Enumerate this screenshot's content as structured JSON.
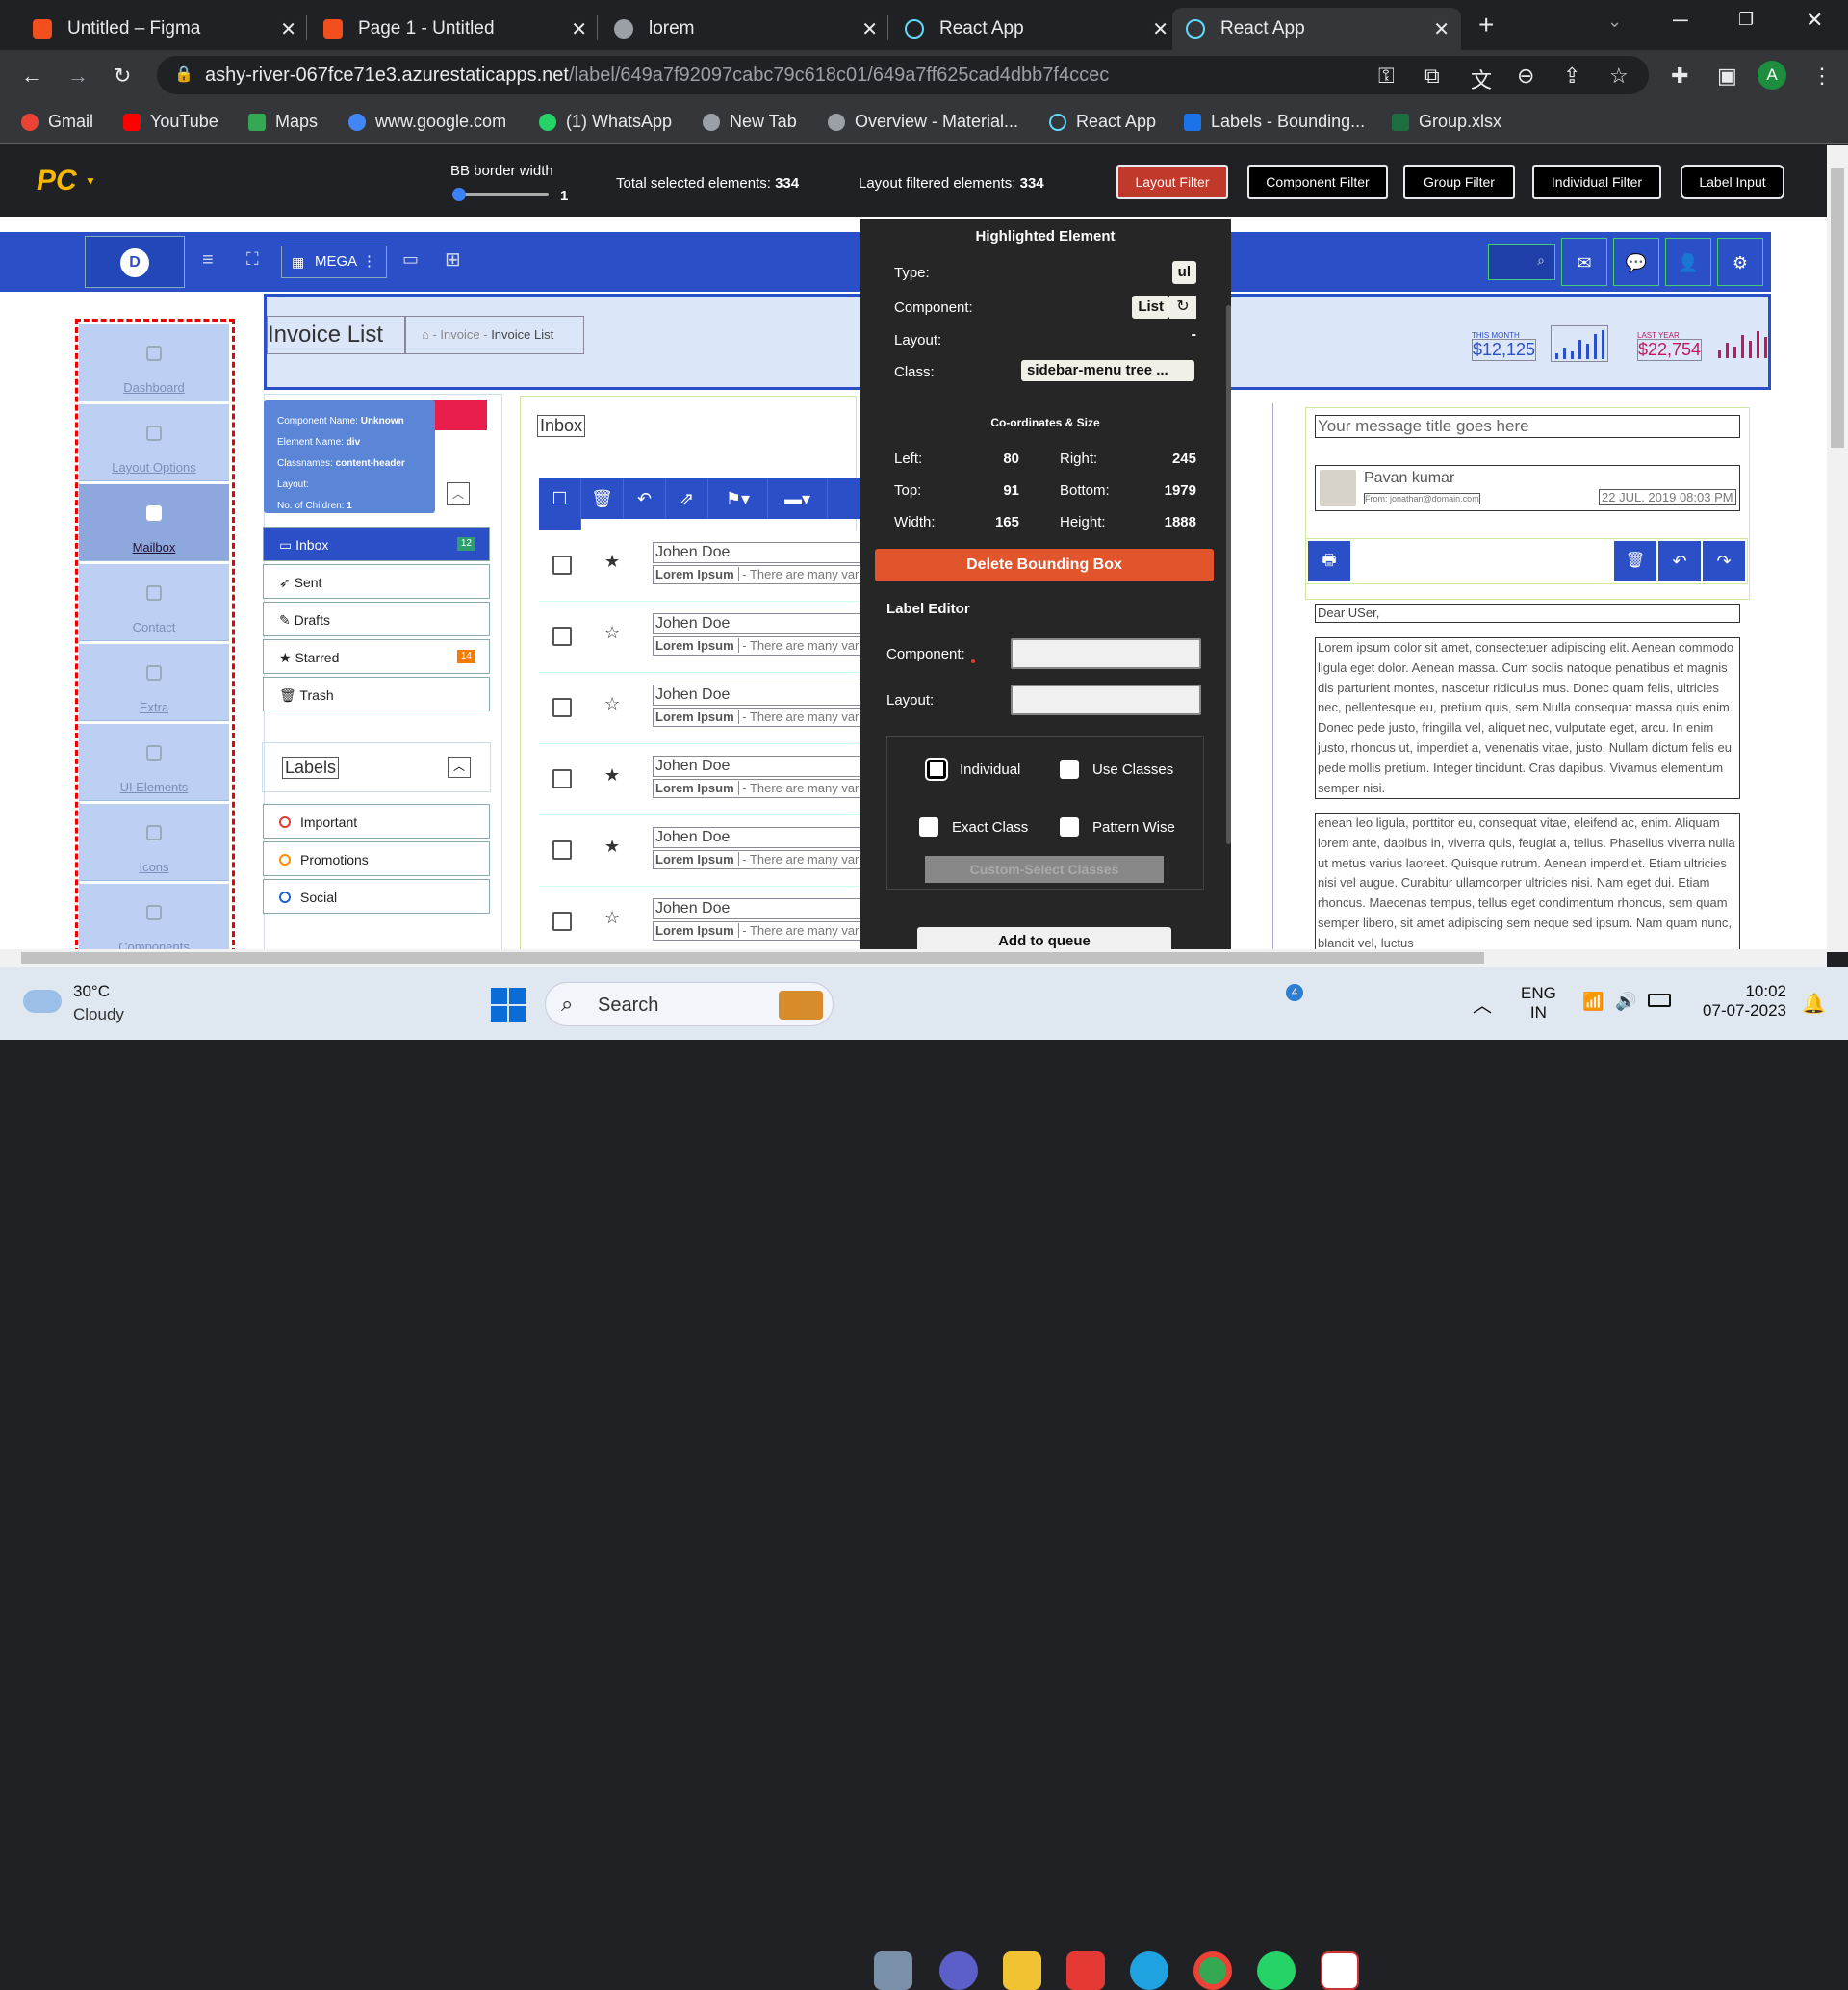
{
  "browser": {
    "tabs": [
      {
        "title": "Untitled – Figma",
        "color": "#f24e1e"
      },
      {
        "title": "Page 1 - Untitled",
        "color": "#f24e1e"
      },
      {
        "title": "lorem",
        "color": "#9aa0a6"
      },
      {
        "title": "React App",
        "color": "#61dafb"
      },
      {
        "title": "React App",
        "color": "#61dafb"
      }
    ],
    "url_domain": "ashy-river-067fce71e3.azurestaticapps.net",
    "url_path": "/label/649a7f92097cabc79c618c01/649a7ff625cad4dbb7f4ccec",
    "profile_initial": "A",
    "bookmarks": [
      "Gmail",
      "YouTube",
      "Maps",
      "www.google.com",
      "(1) WhatsApp",
      "New Tab",
      "Overview - Material...",
      "React App",
      "Labels - Bounding...",
      "Group.xlsx"
    ]
  },
  "toolbar": {
    "logo": "PC",
    "bb_label": "BB border width",
    "bb_value": "1",
    "bb_slider_fraction": 0.0,
    "total_label": "Total selected elements:",
    "total_value": "334",
    "layout_label": "Layout filtered elements:",
    "layout_value": "334",
    "filters": [
      "Layout Filter",
      "Component Filter",
      "Group Filter",
      "Individual Filter",
      "Label Input"
    ]
  },
  "app": {
    "mega": "MEGA",
    "sidebar": [
      "Dashboard",
      "Layout Options",
      "Mailbox",
      "Contact",
      "Extra",
      "UI Elements",
      "Icons",
      "Components"
    ],
    "page_title": "Invoice List",
    "breadcrumb": [
      "Invoice",
      "Invoice List"
    ],
    "stat1_label": "THIS MONTH",
    "stat1_value": "$12,125",
    "stat2_label": "LAST YEAR",
    "stat2_value": "$22,754",
    "tooltip": {
      "component_label": "Component Name:",
      "component_value": "Unknown",
      "element_label": "Element Name:",
      "element_value": "div",
      "class_label": "Classnames:",
      "class_value": "content-header",
      "layout_label": "Layout:",
      "children_label": "No. of Children:",
      "children_value": "1"
    },
    "folders": [
      {
        "label": "Inbox",
        "badge": "12"
      },
      {
        "label": "Sent",
        "badge": ""
      },
      {
        "label": "Drafts",
        "badge": ""
      },
      {
        "label": "Starred",
        "badge": "14"
      },
      {
        "label": "Trash",
        "badge": ""
      }
    ],
    "labels_title": "Labels",
    "labels": [
      {
        "label": "Important",
        "color": "#e53935"
      },
      {
        "label": "Promotions",
        "color": "#fb8c00"
      },
      {
        "label": "Social",
        "color": "#1e63c8"
      }
    ],
    "inbox_title": "Inbox",
    "mails": [
      {
        "name": "Johen Doe",
        "subject": "Lorem Ipsum",
        "preview": "- There are many vari",
        "starred": true
      },
      {
        "name": "Johen Doe",
        "subject": "Lorem Ipsum",
        "preview": "- There are many vari",
        "starred": false
      },
      {
        "name": "Johen Doe",
        "subject": "Lorem Ipsum",
        "preview": "- There are many vari",
        "starred": false
      },
      {
        "name": "Johen Doe",
        "subject": "Lorem Ipsum",
        "preview": "- There are many vari",
        "starred": true
      },
      {
        "name": "Johen Doe",
        "subject": "Lorem Ipsum",
        "preview": "- There are many vari",
        "starred": true
      },
      {
        "name": "Johen Doe",
        "subject": "Lorem Ipsum",
        "preview": "- There are many vari",
        "starred": false
      }
    ],
    "message": {
      "title_placeholder": "Your message title goes here",
      "sender": "Pavan kumar",
      "from": "From: jonathan@domain.com",
      "date": "22 JUL. 2019 08:03 PM",
      "greeting": "Dear USer,",
      "para1": "Lorem ipsum dolor sit amet, consectetuer adipiscing elit. Aenean commodo ligula eget dolor. Aenean massa. Cum sociis natoque penatibus et magnis dis parturient montes, nascetur ridiculus mus. Donec quam felis, ultricies nec, pellentesque eu, pretium quis, sem.Nulla consequat massa quis enim. Donec pede justo, fringilla vel, aliquet nec, vulputate eget, arcu. In enim justo, rhoncus ut, imperdiet a, venenatis vitae, justo. Nullam dictum felis eu pede mollis pretium. Integer tincidunt. Cras dapibus. Vivamus elementum semper nisi.",
      "para2": "enean leo ligula, porttitor eu, consequat vitae, eleifend ac, enim. Aliquam lorem ante, dapibus in, viverra quis, feugiat a, tellus. Phasellus viverra nulla ut metus varius laoreet. Quisque rutrum. Aenean imperdiet. Etiam ultricies nisi vel augue. Curabitur ullamcorper ultricies nisi. Nam eget dui. Etiam rhoncus. Maecenas tempus, tellus eget condimentum rhoncus, sem quam semper libero, sit amet adipiscing sem neque sed ipsum. Nam quam nunc, blandit vel, luctus"
    }
  },
  "panel": {
    "title": "Highlighted Element",
    "type_label": "Type:",
    "type_value": "ul",
    "component_label": "Component:",
    "component_value": "List",
    "layout_label": "Layout:",
    "layout_value": "-",
    "class_label": "Class:",
    "class_value": "sidebar-menu tree ...",
    "coords_title": "Co-ordinates & Size",
    "left_label": "Left:",
    "left_value": "80",
    "right_label": "Right:",
    "right_value": "245",
    "top_label": "Top:",
    "top_value": "91",
    "bottom_label": "Bottom:",
    "bottom_value": "1979",
    "width_label": "Width:",
    "width_value": "165",
    "height_label": "Height:",
    "height_value": "1888",
    "delete_label": "Delete Bounding Box",
    "editor_title": "Label Editor",
    "comp_input_label": "Component:",
    "layout_input_label": "Layout:",
    "opt_individual": "Individual",
    "opt_use_classes": "Use Classes",
    "opt_exact": "Exact Class",
    "opt_pattern": "Pattern Wise",
    "custom_select": "Custom-Select Classes",
    "queue": "Add to queue"
  },
  "taskbar": {
    "temp": "30°C",
    "weather": "Cloudy",
    "search": "Search",
    "lang1": "ENG",
    "lang2": "IN",
    "time": "10:02",
    "date": "07-07-2023",
    "whatsapp_badge": "4"
  }
}
